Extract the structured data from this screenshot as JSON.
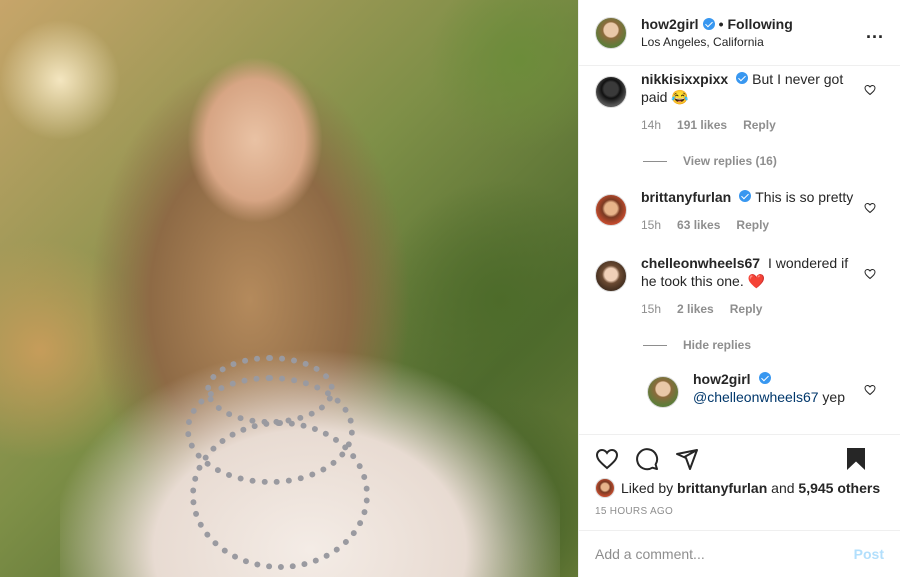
{
  "header": {
    "username": "how2girl",
    "separator": "•",
    "follow_label": "Following",
    "location": "Los Angeles, California",
    "more_label": "..."
  },
  "comments": [
    {
      "username": "nikkisixxpixx",
      "text": "But I never got paid 😂",
      "time": "14h",
      "likes": "191 likes",
      "reply_label": "Reply",
      "replies_toggle": "View replies (16)"
    },
    {
      "username": "brittanyfurlan",
      "text": "This is so pretty",
      "time": "15h",
      "likes": "63 likes",
      "reply_label": "Reply"
    },
    {
      "username": "chelleonwheels67",
      "text": "I wondered if he took this one. ❤️",
      "time": "15h",
      "likes": "2 likes",
      "reply_label": "Reply",
      "replies_toggle": "Hide replies"
    }
  ],
  "reply": {
    "username": "how2girl",
    "mention": "@chelleonwheels67",
    "text": "yep"
  },
  "liked": {
    "prefix": "Liked by",
    "user": "brittanyfurlan",
    "and": "and",
    "count": "5,945 others"
  },
  "timestamp": "15 HOURS AGO",
  "add_comment": {
    "placeholder": "Add a comment...",
    "post_label": "Post"
  },
  "colors": {
    "verified": "#3897f0",
    "post_disabled": "#b2dffc",
    "muted": "#8e8e8e",
    "heart_red": "#e0245e"
  },
  "icons": [
    "heart-icon",
    "comment-icon",
    "share-icon",
    "bookmark-icon",
    "verified-badge-icon",
    "more-options-icon"
  ]
}
